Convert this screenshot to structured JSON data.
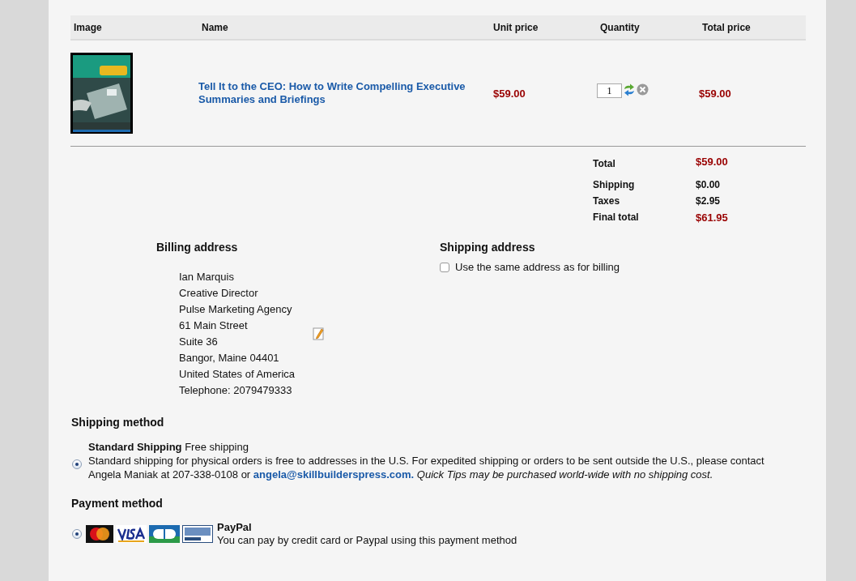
{
  "cart": {
    "columns": [
      "Image",
      "Name",
      "Unit price",
      "Quantity",
      "Total price"
    ],
    "items": [
      {
        "name": "Tell It to the CEO: How to Write Compelling Executive Summaries and Briefings",
        "unit_price": "$59.00",
        "quantity": "1",
        "total_price": "$59.00"
      }
    ]
  },
  "totals": [
    {
      "label": "Total",
      "value": "$59.00",
      "highlight": true
    },
    {
      "label": "Shipping",
      "value": "$0.00",
      "highlight": false
    },
    {
      "label": "Taxes",
      "value": "$2.95",
      "highlight": false
    },
    {
      "label": "Final total",
      "value": "$61.95",
      "highlight": true
    }
  ],
  "billing": {
    "title": "Billing address",
    "lines": [
      "Ian Marquis",
      "Creative Director",
      "Pulse Marketing Agency",
      "61 Main Street",
      "Suite 36",
      "Bangor, Maine 04401",
      "United States of America",
      "Telephone: 2079479333"
    ]
  },
  "shipping_address": {
    "title": "Shipping address",
    "same_as_billing": {
      "label": "Use the same address as for billing",
      "checked": false
    }
  },
  "shipping_method": {
    "title": "Shipping method",
    "options": [
      {
        "name": "**Standard Shipping** Free shipping",
        "description": "Standard shipping for physical orders is free to addresses in the U.S. For expedited shipping or orders to be sent outside the U.S., please contact Angela Maniak at 207-338-0108 or",
        "email": "angela@skillbuilderspress.com.",
        "note": "Quick Tips may be purchased world-wide with no shipping cost.",
        "selected": true
      }
    ]
  },
  "payment_method": {
    "title": "Payment method",
    "options": [
      {
        "name": "PayPal",
        "description": "You can pay by credit card or Paypal using this payment method",
        "selected": true
      }
    ]
  }
}
